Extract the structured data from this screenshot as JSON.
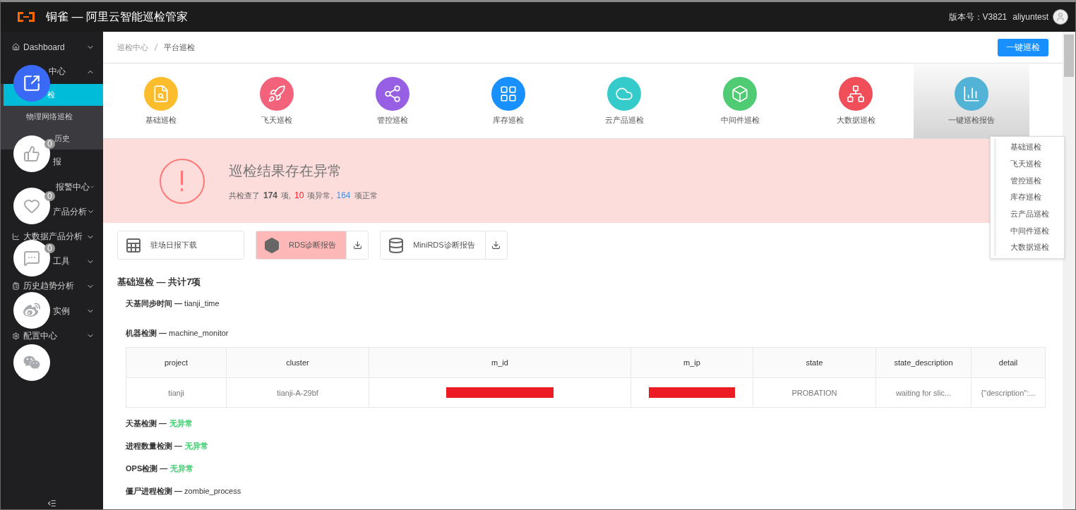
{
  "header": {
    "title": "铜雀 — 阿里云智能巡检管家",
    "version": "版本号：V3821",
    "user": "aliyuntest"
  },
  "sidebar": {
    "items": [
      {
        "kind": "group",
        "label": "Dashboard",
        "expanded": false
      },
      {
        "kind": "group",
        "label": "中心",
        "expanded": true,
        "children": [
          {
            "label": "检",
            "selected": true
          },
          {
            "label": "物理网络巡检",
            "selected": false
          },
          {
            "label": "历史",
            "selected": false
          }
        ]
      },
      {
        "kind": "link",
        "label": "报"
      },
      {
        "kind": "group",
        "label": "报警中心",
        "expanded": false
      },
      {
        "kind": "group",
        "label": "产品分析",
        "expanded": false
      },
      {
        "kind": "group",
        "label": "大数据产品分析",
        "expanded": false
      },
      {
        "kind": "group",
        "label": "工具",
        "expanded": false
      },
      {
        "kind": "group",
        "label": "历史趋势分析",
        "expanded": false
      },
      {
        "kind": "group",
        "label": "实例",
        "expanded": false
      },
      {
        "kind": "group",
        "label": "配置中心",
        "expanded": false
      }
    ]
  },
  "share_bar": [
    {
      "kind": "edit"
    },
    {
      "kind": "like",
      "count": "0"
    },
    {
      "kind": "heart",
      "count": "0"
    },
    {
      "kind": "comment",
      "count": "0"
    },
    {
      "kind": "weibo"
    },
    {
      "kind": "wechat"
    }
  ],
  "breadcrumb": [
    "巡检中心",
    "平台巡检"
  ],
  "primary_button": "一键巡检",
  "categories": [
    {
      "label": "基础巡检",
      "color": "#fbbd2c",
      "selected": false
    },
    {
      "label": "飞天巡检",
      "color": "#f2637b",
      "selected": false
    },
    {
      "label": "管控巡检",
      "color": "#975fe4",
      "selected": false
    },
    {
      "label": "库存巡检",
      "color": "#1890ff",
      "selected": false
    },
    {
      "label": "云产品巡检",
      "color": "#36cbcb",
      "selected": false
    },
    {
      "label": "中间件巡检",
      "color": "#4ecb73",
      "selected": false
    },
    {
      "label": "大数据巡检",
      "color": "#f04f5a",
      "selected": false
    },
    {
      "label": "一键巡检报告",
      "color": "#53b3d6",
      "selected": true
    }
  ],
  "report_menu": [
    "基础巡检",
    "飞天巡检",
    "管控巡检",
    "库存巡检",
    "云产品巡检",
    "中间件巡检",
    "大数据巡检"
  ],
  "result": {
    "title": "巡检结果存在异常",
    "summary": [
      {
        "kind": "plain",
        "text": "共检查了"
      },
      {
        "kind": "total",
        "text": "174"
      },
      {
        "kind": "plain",
        "text": "项,"
      },
      {
        "kind": "abnormal",
        "text": "10"
      },
      {
        "kind": "plain",
        "text": "项异常,"
      },
      {
        "kind": "normal",
        "text": "164"
      },
      {
        "kind": "plain",
        "text": "项正常"
      }
    ]
  },
  "reports": [
    {
      "label": "驻场日报下载",
      "highlighted": false,
      "download": false
    },
    {
      "label": "RDS诊断报告",
      "highlighted": true,
      "download": true
    },
    {
      "label": "MiniRDS诊断报告",
      "highlighted": false,
      "download": true
    }
  ],
  "section": {
    "title": "基础巡检 — 共计7项",
    "checks": [
      {
        "kind": "plain",
        "title": "**天基同步时间 —** tianji_time"
      },
      {
        "kind": "table",
        "title": "**机器检测 —** machine_monitor",
        "table": {
          "columns": [
            "project",
            "cluster",
            "m_id",
            "m_ip",
            "state",
            "state_description",
            "detail"
          ],
          "rows": [
            [
              {
                "text": "tianji"
              },
              {
                "text": "tianji-A-29bf"
              },
              {
                "kind": "redacted"
              },
              {
                "kind": "redacted"
              },
              {
                "text": "PROBATION"
              },
              {
                "text": "waiting for slic..."
              },
              {
                "text": "{\"description\":..."
              }
            ]
          ]
        }
      },
      {
        "kind": "ok",
        "title": "天基检测 —",
        "status": "无异常"
      },
      {
        "kind": "ok",
        "title": "进程数量检测 —",
        "status": "无异常"
      },
      {
        "kind": "ok",
        "title": "OPS检测 —",
        "status": "无异常"
      },
      {
        "kind": "plain",
        "title": "**僵尸进程检测 —** zombie_process"
      }
    ]
  }
}
